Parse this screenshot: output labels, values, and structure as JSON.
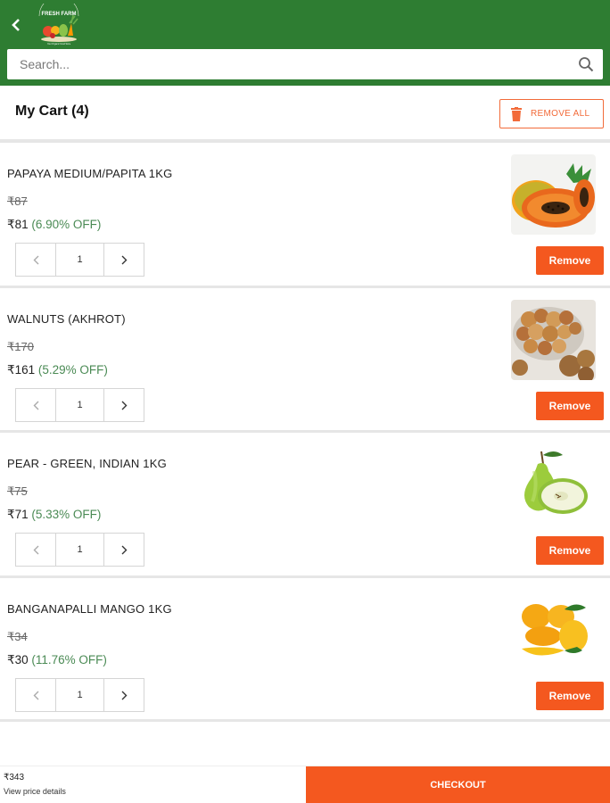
{
  "header": {
    "back_icon": "chevron-left-icon",
    "logo_text": "FRESH FARM",
    "logo_tagline": "Your Organic Food Store",
    "brand_color": "#2e7d32"
  },
  "search": {
    "placeholder": "Search...",
    "icon": "search-icon"
  },
  "cart": {
    "title": "My Cart (4)",
    "remove_all_label": "REMOVE ALL",
    "remove_all_icon": "trash-icon",
    "accent_color": "#f4581f"
  },
  "items": [
    {
      "name": "PAPAYA MEDIUM/PAPITA 1KG",
      "mrp": "₹87",
      "price": "₹81",
      "discount": "(6.90% OFF)",
      "quantity": "1",
      "remove_label": "Remove",
      "image_icon": "papaya-image"
    },
    {
      "name": "WALNUTS (AKHROT)",
      "mrp": "₹170",
      "price": "₹161",
      "discount": "(5.29% OFF)",
      "quantity": "1",
      "remove_label": "Remove",
      "image_icon": "walnuts-image"
    },
    {
      "name": "PEAR - GREEN, INDIAN 1KG",
      "mrp": "₹75",
      "price": "₹71",
      "discount": "(5.33% OFF)",
      "quantity": "1",
      "remove_label": "Remove",
      "image_icon": "pear-image"
    },
    {
      "name": "BANGANAPALLI MANGO 1KG",
      "mrp": "₹34",
      "price": "₹30",
      "discount": "(11.76% OFF)",
      "quantity": "1",
      "remove_label": "Remove",
      "image_icon": "mango-image"
    }
  ],
  "footer": {
    "total": "₹343",
    "price_details_label": "View price details",
    "checkout_label": "CHECKOUT"
  }
}
